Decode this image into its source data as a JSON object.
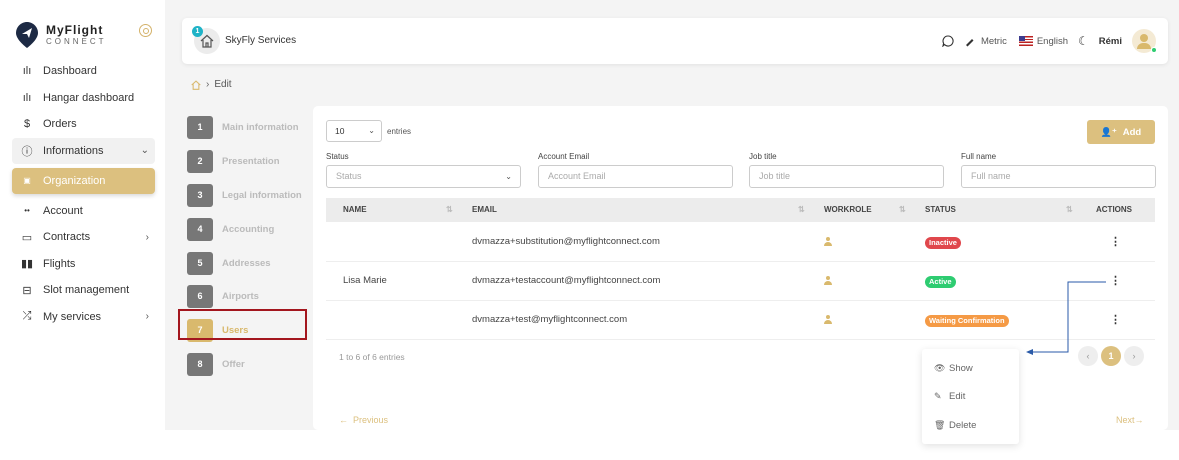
{
  "brand": {
    "name_line1": "MyFlight",
    "name_line2": "CONNECT"
  },
  "sidebar": {
    "items": [
      {
        "label": "Dashboard",
        "icon": "bar-chart-icon"
      },
      {
        "label": "Hangar dashboard",
        "icon": "bar-chart-icon"
      },
      {
        "label": "Orders",
        "icon": "dollar-icon"
      },
      {
        "label": "Informations",
        "icon": "info-icon"
      },
      {
        "label": "Organization",
        "icon": "building-icon"
      },
      {
        "label": "Account",
        "icon": "users-icon"
      },
      {
        "label": "Contracts",
        "icon": "folder-icon"
      },
      {
        "label": "Flights",
        "icon": "luggage-icon"
      },
      {
        "label": "Slot management",
        "icon": "laptop-icon"
      },
      {
        "label": "My services",
        "icon": "shuffle-icon"
      }
    ]
  },
  "topbar": {
    "company": "SkyFly Services",
    "notification_count": "1",
    "unit": "Metric",
    "language": "English",
    "user": "Rémi"
  },
  "breadcrumb": {
    "current": "Edit"
  },
  "steps": [
    {
      "num": "1",
      "label": "Main information"
    },
    {
      "num": "2",
      "label": "Presentation"
    },
    {
      "num": "3",
      "label": "Legal information"
    },
    {
      "num": "4",
      "label": "Accounting"
    },
    {
      "num": "5",
      "label": "Addresses"
    },
    {
      "num": "6",
      "label": "Airports"
    },
    {
      "num": "7",
      "label": "Users"
    },
    {
      "num": "8",
      "label": "Offer"
    }
  ],
  "table_controls": {
    "page_size": "10",
    "entries_label": "entries",
    "add_label": "Add"
  },
  "filters": {
    "status": {
      "label": "Status",
      "placeholder": "Status"
    },
    "email": {
      "label": "Account Email",
      "placeholder": "Account Email"
    },
    "job": {
      "label": "Job title",
      "placeholder": "Job title"
    },
    "name": {
      "label": "Full name",
      "placeholder": "Full name"
    }
  },
  "columns": {
    "name": "NAME",
    "email": "EMAIL",
    "workrole": "WORKROLE",
    "status": "STATUS",
    "actions": "ACTIONS"
  },
  "rows": [
    {
      "name": "",
      "email": "dvmazza+substitution@myflightconnect.com",
      "status": "Inactive",
      "status_color": "#e0474c"
    },
    {
      "name": "Lisa Marie",
      "email": "dvmazza+testaccount@myflightconnect.com",
      "status": "Active",
      "status_color": "#2ecc71"
    },
    {
      "name": "",
      "email": "dvmazza+test@myflightconnect.com",
      "status": "Waiting Confirmation",
      "status_color": "#f59a45"
    }
  ],
  "footer": {
    "info": "1 to 6 of 6 entries",
    "current_page": "1",
    "prev": "Previous",
    "next": "Next"
  },
  "row_menu": {
    "show": "Show",
    "edit": "Edit",
    "delete": "Delete"
  },
  "colors": {
    "accent": "#dcc07f",
    "highlight": "#a3161e",
    "arrow": "#2a5aa8"
  }
}
